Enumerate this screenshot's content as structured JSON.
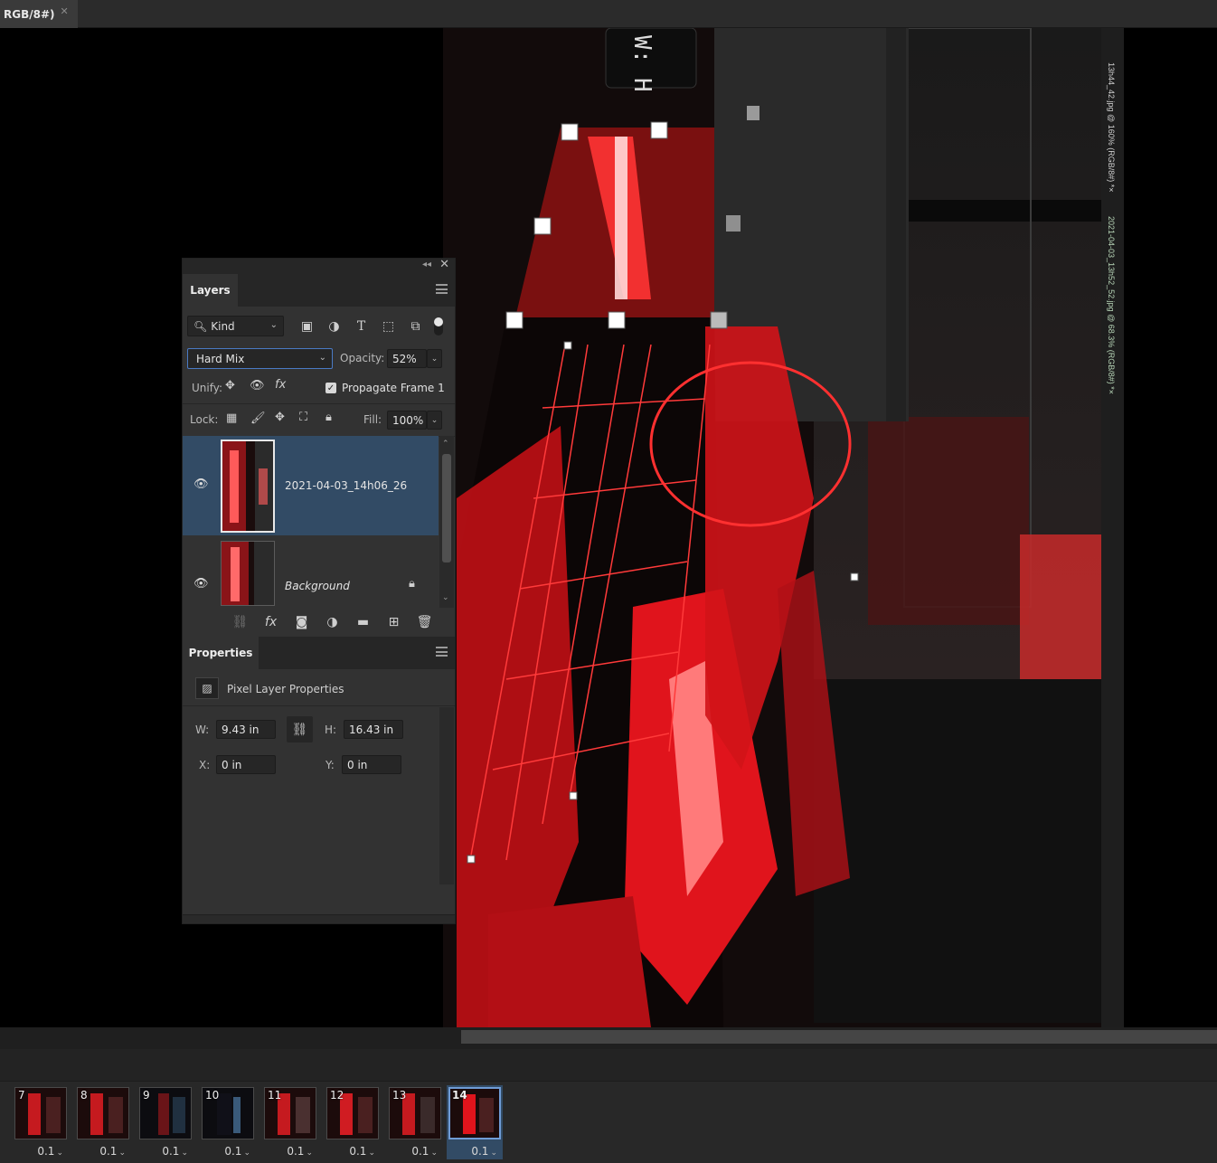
{
  "document": {
    "tab_title": "RGB/8#)",
    "tab_close_glyph": "✕"
  },
  "background_docs": {
    "doc1": "13h44_42.jpg @ 160% (RGB/8#) *×",
    "doc2": "2021-04-03_13h52_52.jpg @ 68.3% (RGB/8#) *×"
  },
  "layers_panel": {
    "tab_label": "Layers",
    "filter_kind": "Kind",
    "blend_mode": "Hard Mix",
    "opacity_label": "Opacity:",
    "opacity_value": "52%",
    "unify_label": "Unify:",
    "propagate_label": "Propagate Frame 1",
    "propagate_checked": true,
    "lock_label": "Lock:",
    "fill_label": "Fill:",
    "fill_value": "100%",
    "layers": [
      {
        "name": "2021-04-03_14h06_26",
        "visible": true,
        "selected": true,
        "italic": false
      },
      {
        "name": "Background",
        "visible": true,
        "selected": false,
        "italic": true,
        "locked": true
      }
    ]
  },
  "properties_panel": {
    "tab_label": "Properties",
    "section_label": "Pixel Layer Properties",
    "w_label": "W:",
    "w_value": "9.43 in",
    "h_label": "H:",
    "h_value": "16.43 in",
    "x_label": "X:",
    "x_value": "0 in",
    "y_label": "Y:",
    "y_value": "0 in"
  },
  "timeline": {
    "frames": [
      {
        "num": "7",
        "delay": "0.1"
      },
      {
        "num": "8",
        "delay": "0.1"
      },
      {
        "num": "9",
        "delay": "0.1"
      },
      {
        "num": "10",
        "delay": "0.1"
      },
      {
        "num": "11",
        "delay": "0.1"
      },
      {
        "num": "12",
        "delay": "0.1"
      },
      {
        "num": "13",
        "delay": "0.1"
      },
      {
        "num": "14",
        "delay": "0.1",
        "active": true
      }
    ]
  },
  "colors": {
    "accent_red": "#e8141c",
    "selection_blue": "#324b65",
    "panel_bg": "#323232"
  }
}
